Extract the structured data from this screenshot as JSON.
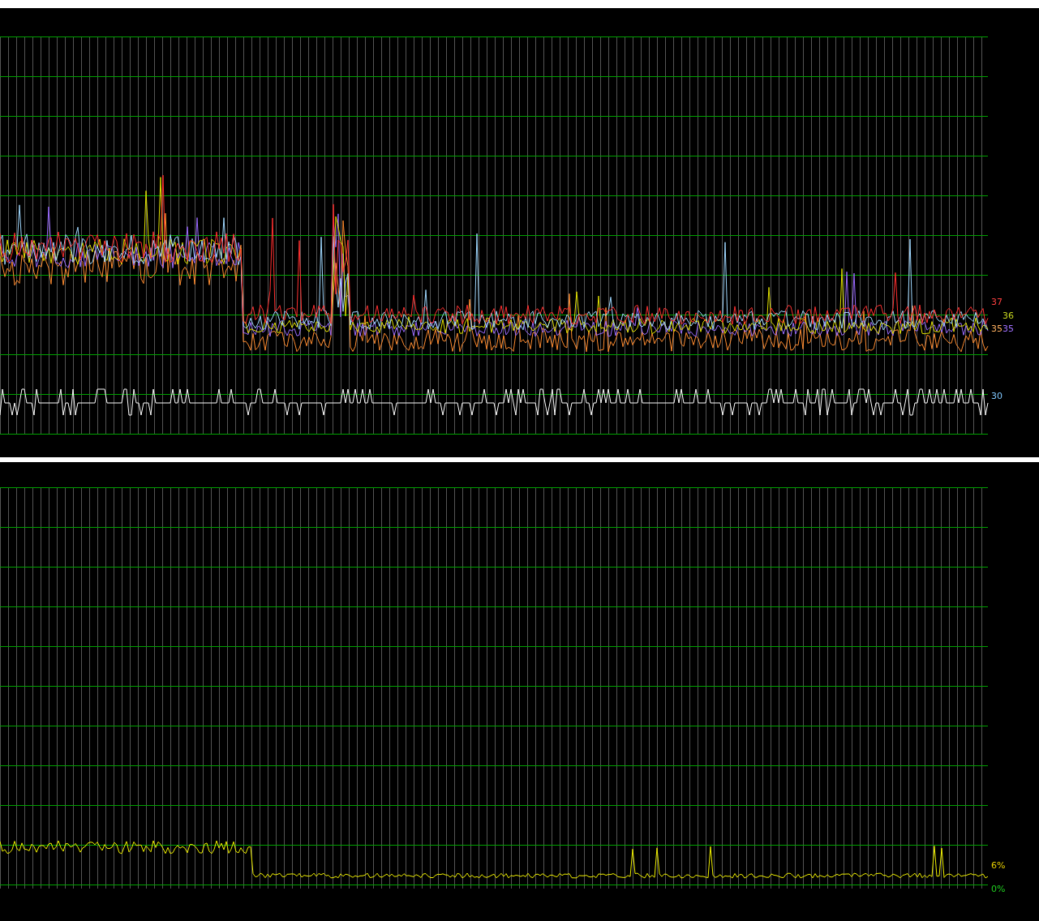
{
  "upper_graph": {
    "labels": [
      {
        "text": "37",
        "color": "#ff4040"
      },
      {
        "text": "36",
        "color": "#c8d820"
      },
      {
        "text": "35",
        "color": "#ffb060"
      },
      {
        "text": "35",
        "color": "#a070ff"
      },
      {
        "text": "30",
        "color": "#80c8ff"
      }
    ]
  },
  "lower_graph": {
    "labels": [
      {
        "text": "6%",
        "color": "#e8d000"
      },
      {
        "text": "0%",
        "color": "#20d020"
      }
    ]
  }
}
